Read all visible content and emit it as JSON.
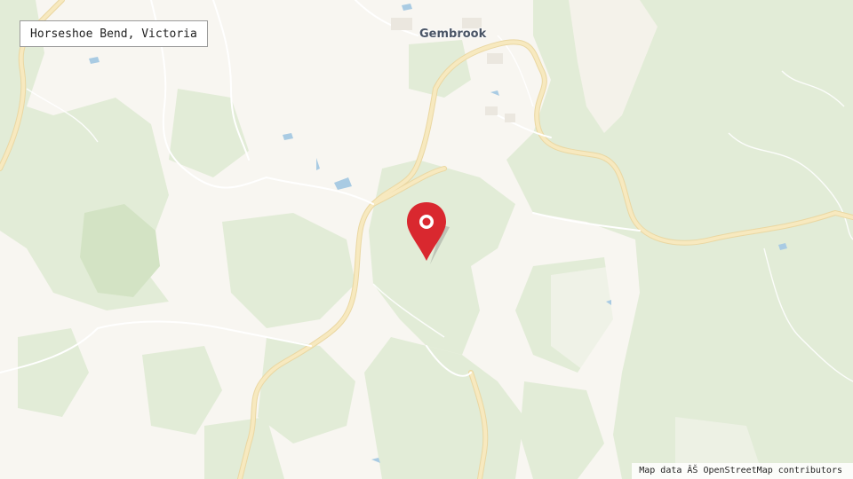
{
  "map": {
    "location_label": "Horseshoe Bend, Victoria",
    "town_name": "Gembrook",
    "attribution": "Map data ÂŠ OpenStreetMap contributors",
    "marker_icon": "map-pin-icon",
    "colors": {
      "land": "#f8f6f1",
      "forest": "#e2ecd7",
      "dense_forest": "#d3e3c4",
      "road": "#f7e9bf",
      "road_edge": "#ead7a2",
      "water": "#a9cbe3",
      "marker": "#d9282f"
    }
  }
}
